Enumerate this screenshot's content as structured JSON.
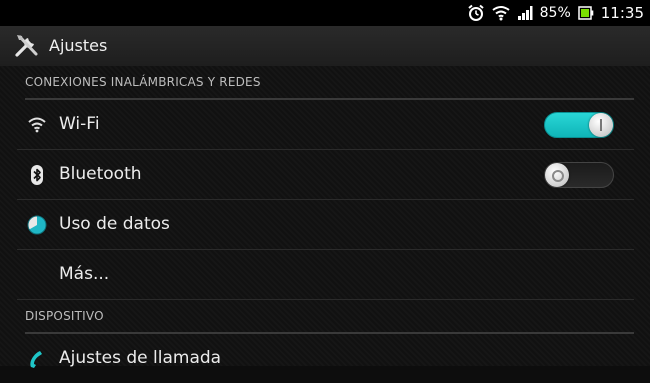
{
  "status_bar": {
    "battery": "85%",
    "time": "11:35",
    "icons": [
      "alarm-icon",
      "wifi-icon",
      "signal-icon",
      "battery-icon"
    ]
  },
  "action_bar": {
    "title": "Ajustes",
    "icon": "settings-tools-icon"
  },
  "sections": {
    "wireless": {
      "header": "CONEXIONES INALÁMBRICAS Y REDES",
      "items": [
        {
          "label": "Wi-Fi",
          "icon": "wifi-icon",
          "toggle": "on"
        },
        {
          "label": "Bluetooth",
          "icon": "bluetooth-icon",
          "toggle": "off"
        },
        {
          "label": "Uso de datos",
          "icon": "data-usage-icon"
        },
        {
          "label": "Más..."
        }
      ]
    },
    "device": {
      "header": "DISPOSITIVO",
      "items": [
        {
          "label": "Ajustes de llamada",
          "icon": "phone-icon"
        }
      ]
    }
  },
  "colors": {
    "accent": "#1fc6c8",
    "background": "#111111",
    "divider": "#3a3a3a"
  }
}
